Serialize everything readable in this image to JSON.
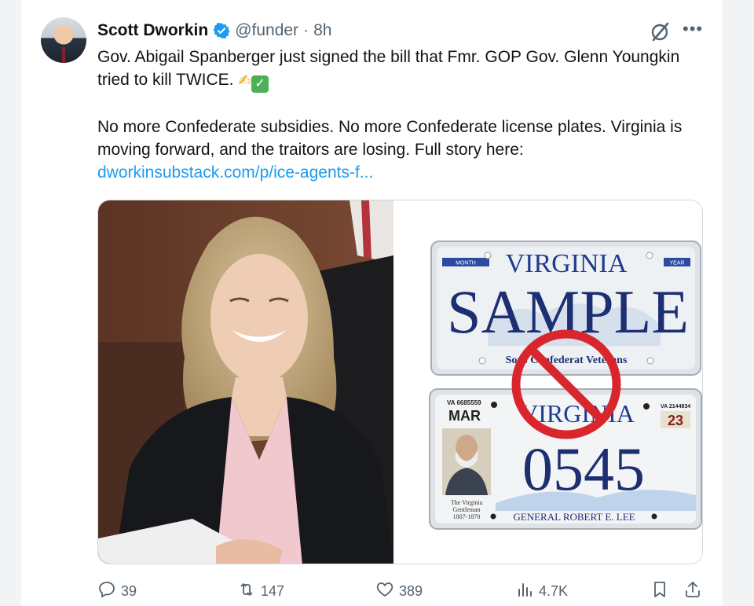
{
  "tweet": {
    "author_name": "Scott Dworkin",
    "handle": "@funder",
    "separator": "·",
    "time": "8h",
    "line1": "Gov. Abigail Spanberger just signed the bill that Fmr. GOP Gov. Glenn Youngkin tried to kill TWICE.",
    "line2": "No more Confederate subsidies. No more Confederate license plates. Virginia is moving forward, and the traitors are losing. Full story here:",
    "link": "dworkinsubstack.com/p/ice-agents-f..."
  },
  "plates": {
    "top_state": "VIRGINIA",
    "top_sample": "SAMPLE",
    "top_month": "MONTH",
    "top_year": "YEAR",
    "top_bottom": "Sons Confederat Veterans",
    "bottom_va_small": "VA 6685559",
    "bottom_month": "MAR",
    "bottom_state": "VIRGINIA",
    "bottom_va_right": "VA 2144834",
    "bottom_year": "23",
    "bottom_number": "0545",
    "portrait_caption1": "The Virginia",
    "portrait_caption2": "Gentleman",
    "portrait_caption3": "1807-1870",
    "bottom_caption": "GENERAL ROBERT E. LEE"
  },
  "actions": {
    "replies": "39",
    "reposts": "147",
    "likes": "389",
    "views": "4.7K"
  },
  "icons": {
    "verified": "verified-badge-icon",
    "grok": "grok-icon",
    "more": "more-icon",
    "reply": "reply-icon",
    "repost": "repost-icon",
    "like": "heart-icon",
    "views": "views-icon",
    "bookmark": "bookmark-icon",
    "share": "share-icon"
  },
  "colors": {
    "link": "#1d9bf0",
    "verified": "#1d9bf0",
    "text_secondary": "#536471",
    "prohibit": "#d9262c"
  }
}
